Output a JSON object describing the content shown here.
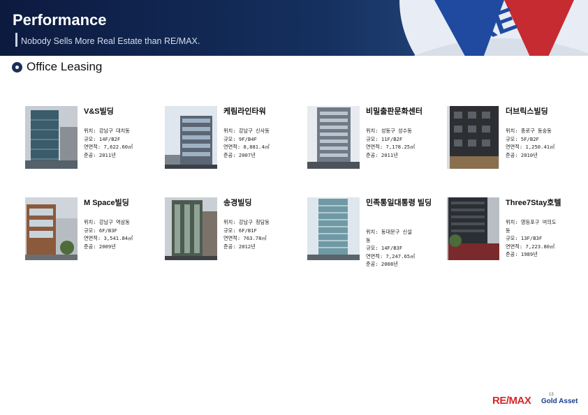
{
  "header": {
    "title": "Performance",
    "subtitle": "Nobody Sells More Real Estate than RE/MAX."
  },
  "section": {
    "title": "Office Leasing"
  },
  "buildings": [
    {
      "name": "V&S빌딩",
      "details": [
        "위치: 강남구 대치동",
        "규모: 14F/B2F",
        "연면적: 7,622.60㎡",
        "준공: 2011년"
      ]
    },
    {
      "name": "케림라인타워",
      "details": [
        "위치: 강남구 신사동",
        "규모: 9F/B4F",
        "연면적: 8,881.4㎡",
        "준공: 2007년"
      ]
    },
    {
      "name": "비밀출판문화센터",
      "details": [
        "위치: 성동구 성수동",
        "규모: 11F/B2F",
        "연면적: 7,178.25㎡",
        "준공: 2011년"
      ]
    },
    {
      "name": "더브릭스빌딩",
      "details": [
        "위치: 종로구 동숭동",
        "규모: 5F/B2F",
        "연면적: 1,250.41㎡",
        "준공: 2010년"
      ]
    },
    {
      "name": "M Space빌딩",
      "details": [
        "위치: 강남구 역삼동",
        "규모: 6F/B3F",
        "연면적: 3,541.84㎡",
        "준공: 2009년"
      ]
    },
    {
      "name": "송경빌딩",
      "details": [
        "위치: 강남구 청담동",
        "규모: 6F/B1F",
        "연면적: 763.78㎡",
        "준공: 2012년"
      ]
    },
    {
      "name": "민족통일대통령 빌딩",
      "details": [
        "위치: 동대문구 신설",
        "동",
        "규모: 14F/B3F",
        "연면적: 7,247.65㎡",
        "준공: 2008년"
      ]
    },
    {
      "name": "Three7Stay호텔",
      "details": [
        "위치: 영등포구 여의도",
        "동",
        "규모: 13F/B3F",
        "연면적: 7,223.80㎡",
        "준공: 1989년"
      ]
    }
  ],
  "footer": {
    "page_number": "13",
    "logo_brand": "RE/MAX",
    "logo_sub": "Gold Asset"
  },
  "colors": {
    "header_dark": "#0c1a3f",
    "brand_red": "#d7262c",
    "brand_blue": "#1a3b8c"
  }
}
